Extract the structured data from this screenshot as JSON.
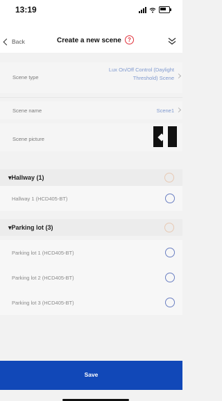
{
  "status": {
    "time": "13:19"
  },
  "nav": {
    "back_label": "Back",
    "title": "Create a new scene",
    "help_icon": "?"
  },
  "settings": {
    "scene_type_label": "Scene type",
    "scene_type_value_line1": "Lux On/Off Control (Daylight",
    "scene_type_value_line2": "Threshold) Scene",
    "scene_name_label": "Scene name",
    "scene_name_value": "Scene1",
    "scene_picture_label": "Scene picture"
  },
  "groups": [
    {
      "title": "▾Hallway (1)",
      "devices": [
        "Hallway 1 (HCD405-BT)"
      ]
    },
    {
      "title": "▾Parking lot (3)",
      "devices": [
        "Parking lot 1 (HCD405-BT)",
        "Parking lot 2 (HCD405-BT)",
        "Parking lot 3 (HCD405-BT)"
      ]
    }
  ],
  "footer": {
    "save_label": "Save"
  },
  "colors": {
    "accent": "#1148b8",
    "help": "#e0303a",
    "link": "#7f99cf"
  },
  "icons": [
    "chevron-left-icon",
    "help-icon",
    "collapse-chevrons-icon",
    "radio-icon"
  ]
}
